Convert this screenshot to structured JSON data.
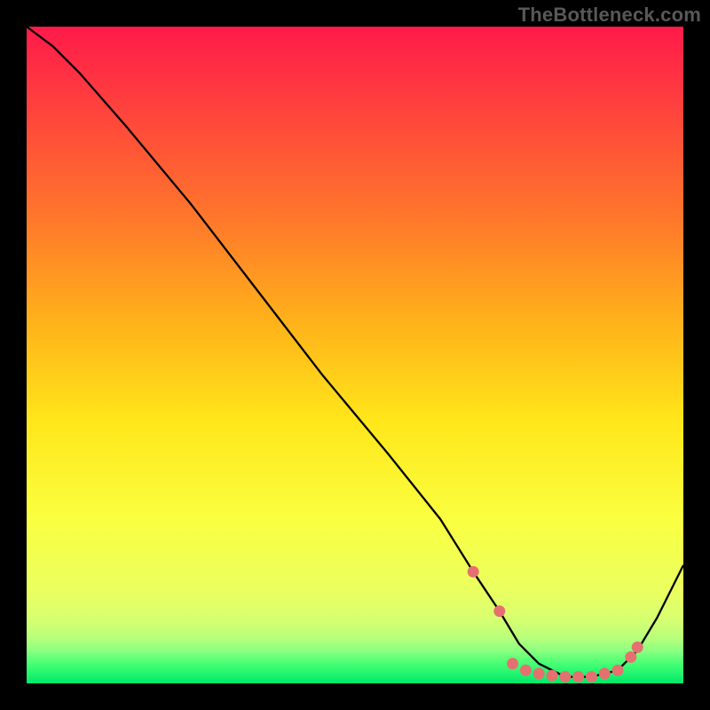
{
  "watermark": "TheBottleneck.com",
  "chart_data": {
    "type": "line",
    "title": "",
    "xlabel": "",
    "ylabel": "",
    "xlim": [
      0,
      100
    ],
    "ylim": [
      0,
      100
    ],
    "grid": false,
    "legend": false,
    "background": "red-yellow-green-vertical-gradient",
    "series": [
      {
        "name": "bottleneck-curve",
        "x": [
          0,
          4,
          8,
          15,
          25,
          35,
          45,
          55,
          63,
          68,
          72,
          75,
          78,
          82,
          86,
          90,
          93,
          96,
          100
        ],
        "y": [
          100,
          97,
          93,
          85,
          73,
          60,
          47,
          35,
          25,
          17,
          11,
          6,
          3,
          1,
          1,
          2,
          5,
          10,
          18
        ]
      }
    ],
    "markers": {
      "series": "bottleneck-curve",
      "color": "#e4716f",
      "points": [
        {
          "x": 68,
          "y": 17
        },
        {
          "x": 72,
          "y": 11
        },
        {
          "x": 74,
          "y": 3
        },
        {
          "x": 76,
          "y": 2
        },
        {
          "x": 78,
          "y": 1.5
        },
        {
          "x": 80,
          "y": 1.2
        },
        {
          "x": 82,
          "y": 1
        },
        {
          "x": 84,
          "y": 1
        },
        {
          "x": 86,
          "y": 1
        },
        {
          "x": 88,
          "y": 1.5
        },
        {
          "x": 90,
          "y": 2
        },
        {
          "x": 92,
          "y": 4
        },
        {
          "x": 93,
          "y": 5.5
        }
      ]
    }
  }
}
